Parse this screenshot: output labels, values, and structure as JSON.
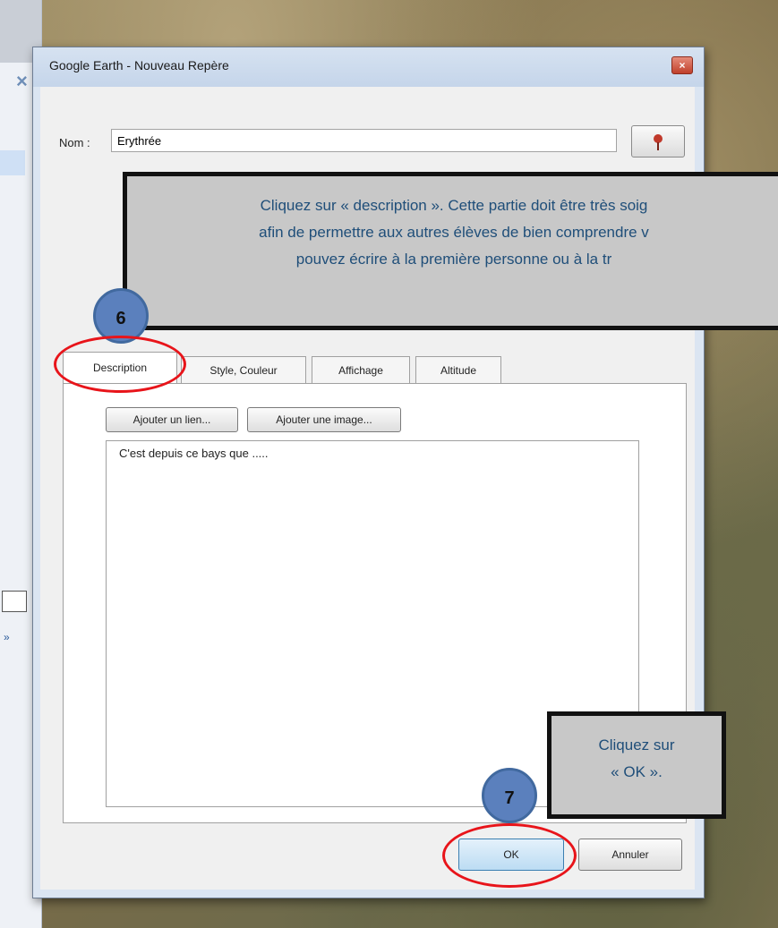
{
  "dialog": {
    "title": "Google Earth - Nouveau Repère",
    "close_label": "×"
  },
  "name": {
    "label": "Nom :",
    "value": "Erythrée"
  },
  "tabs": [
    {
      "label": "Description",
      "active": true
    },
    {
      "label": "Style, Couleur",
      "active": false
    },
    {
      "label": "Affichage",
      "active": false
    },
    {
      "label": "Altitude",
      "active": false
    }
  ],
  "description": {
    "add_link_label": "Ajouter un lien...",
    "add_image_label": "Ajouter une image...",
    "text": "C'est depuis ce bays que ....."
  },
  "buttons": {
    "ok_label": "OK",
    "cancel_label": "Annuler"
  },
  "callouts": {
    "main_lines": [
      "Cliquez sur « description ». Cette partie doit être très soig",
      "afin de permettre aux autres élèves de bien comprendre v",
      "pouvez écrire à la première personne ou à la tr"
    ],
    "ok_lines": [
      "Cliquez sur",
      "« OK »."
    ],
    "step_description": "6",
    "step_ok": "7"
  },
  "colors": {
    "callout_text": "#1f4e79",
    "badge": "#5b80bd",
    "highlight_ring": "#e8141a"
  },
  "icons": {
    "placemark": "pushpin-icon",
    "close": "close-icon"
  }
}
